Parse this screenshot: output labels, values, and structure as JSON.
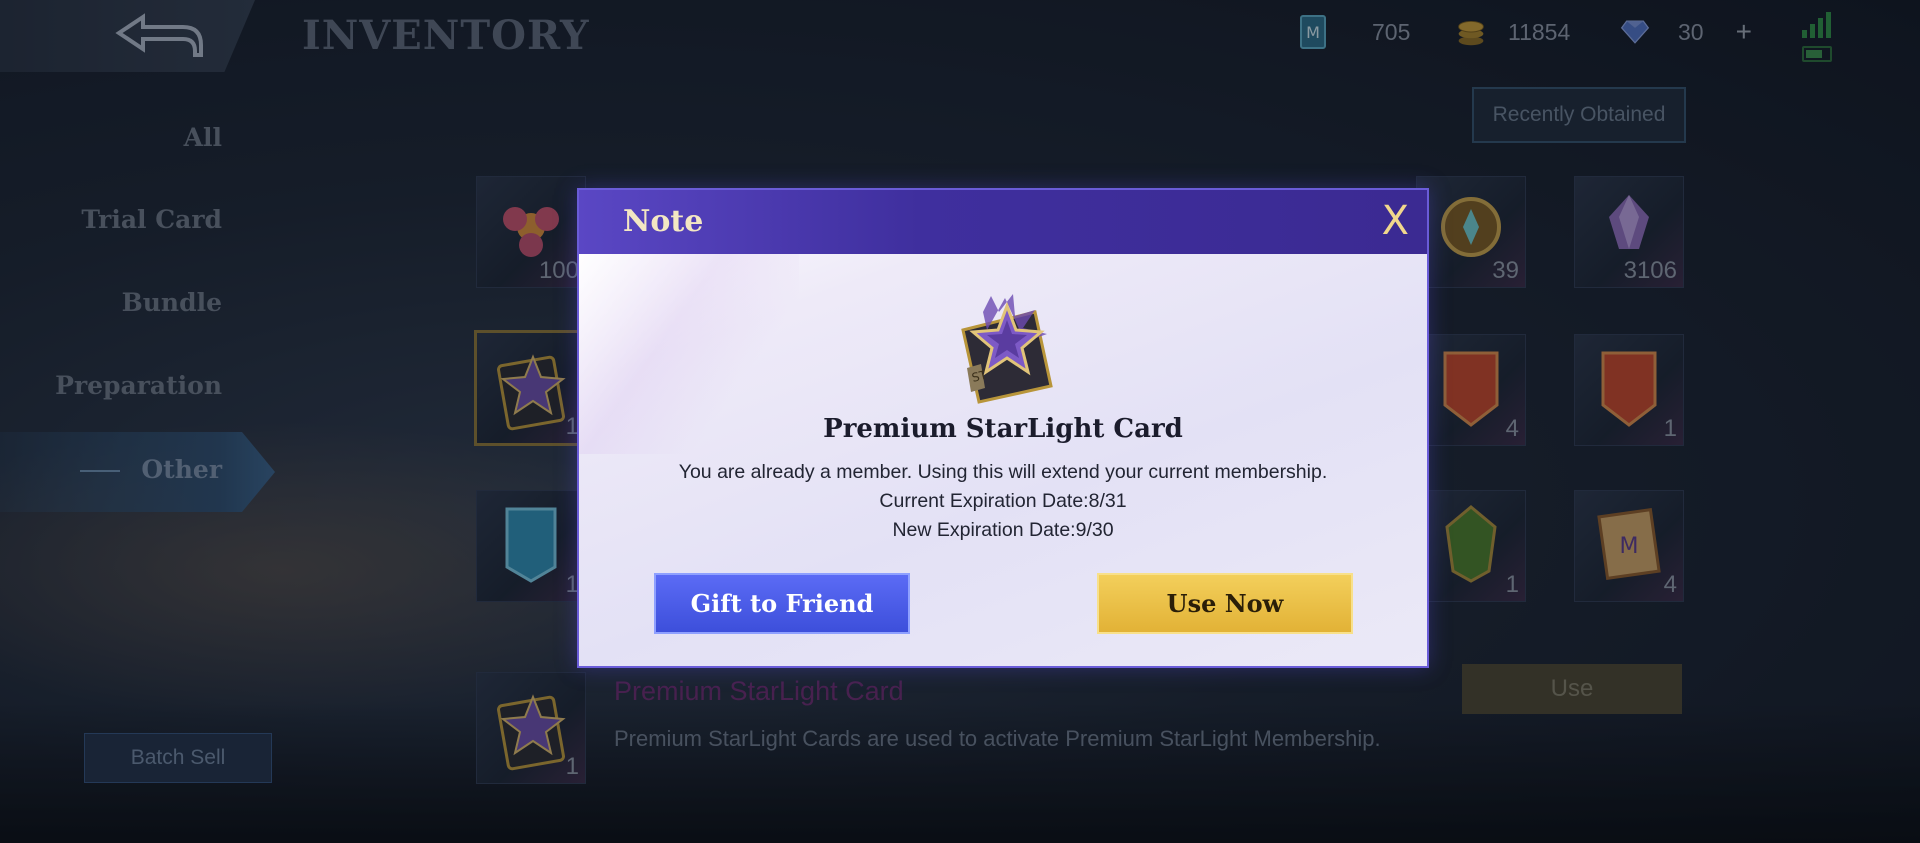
{
  "header": {
    "title": "INVENTORY",
    "currencies": [
      {
        "icon": "m-coupon-icon",
        "value": "705"
      },
      {
        "icon": "gold-coin-icon",
        "value": "11854"
      },
      {
        "icon": "diamond-icon",
        "value": "30"
      }
    ],
    "add_label": "+"
  },
  "sidebar": {
    "items": [
      {
        "label": "All"
      },
      {
        "label": "Trial Card"
      },
      {
        "label": "Bundle"
      },
      {
        "label": "Preparation"
      },
      {
        "label": "Other",
        "active": true
      }
    ],
    "batch_sell_label": "Batch Sell"
  },
  "filter": {
    "recent_label": "Recently Obtained"
  },
  "grid": {
    "items": [
      {
        "name": "flower-item",
        "count": "100"
      },
      {
        "name": "emblem-item",
        "count": "39"
      },
      {
        "name": "crystal-item",
        "count": "3106"
      },
      {
        "name": "starlight-card-item",
        "count": "1"
      },
      {
        "name": "red-banner-item",
        "count": "4"
      },
      {
        "name": "red-banner-item-2",
        "count": "1"
      },
      {
        "name": "blue-banner-item",
        "count": "1"
      },
      {
        "name": "green-crest-item",
        "count": "1"
      },
      {
        "name": "scroll-item",
        "count": "4"
      },
      {
        "name": "starlight-card-thumb",
        "count": "1"
      }
    ]
  },
  "detail": {
    "name": "Premium StarLight Card",
    "description": "Premium StarLight Cards are used to activate Premium StarLight Membership.",
    "use_label": "Use"
  },
  "dialog": {
    "title": "Note",
    "close_label": "X",
    "item_name": "Premium StarLight Card",
    "message": "You are already a member. Using this will extend your current membership.",
    "current_expiration": "Current Expiration Date:8/31",
    "new_expiration": "New Expiration Date:9/30",
    "gift_label": "Gift to Friend",
    "use_now_label": "Use Now"
  },
  "colors": {
    "dialog_header": "#3f2f9e",
    "gift_button": "#4a5be8",
    "use_now_button": "#e9bf45",
    "title_text": "#f3e7c3"
  }
}
